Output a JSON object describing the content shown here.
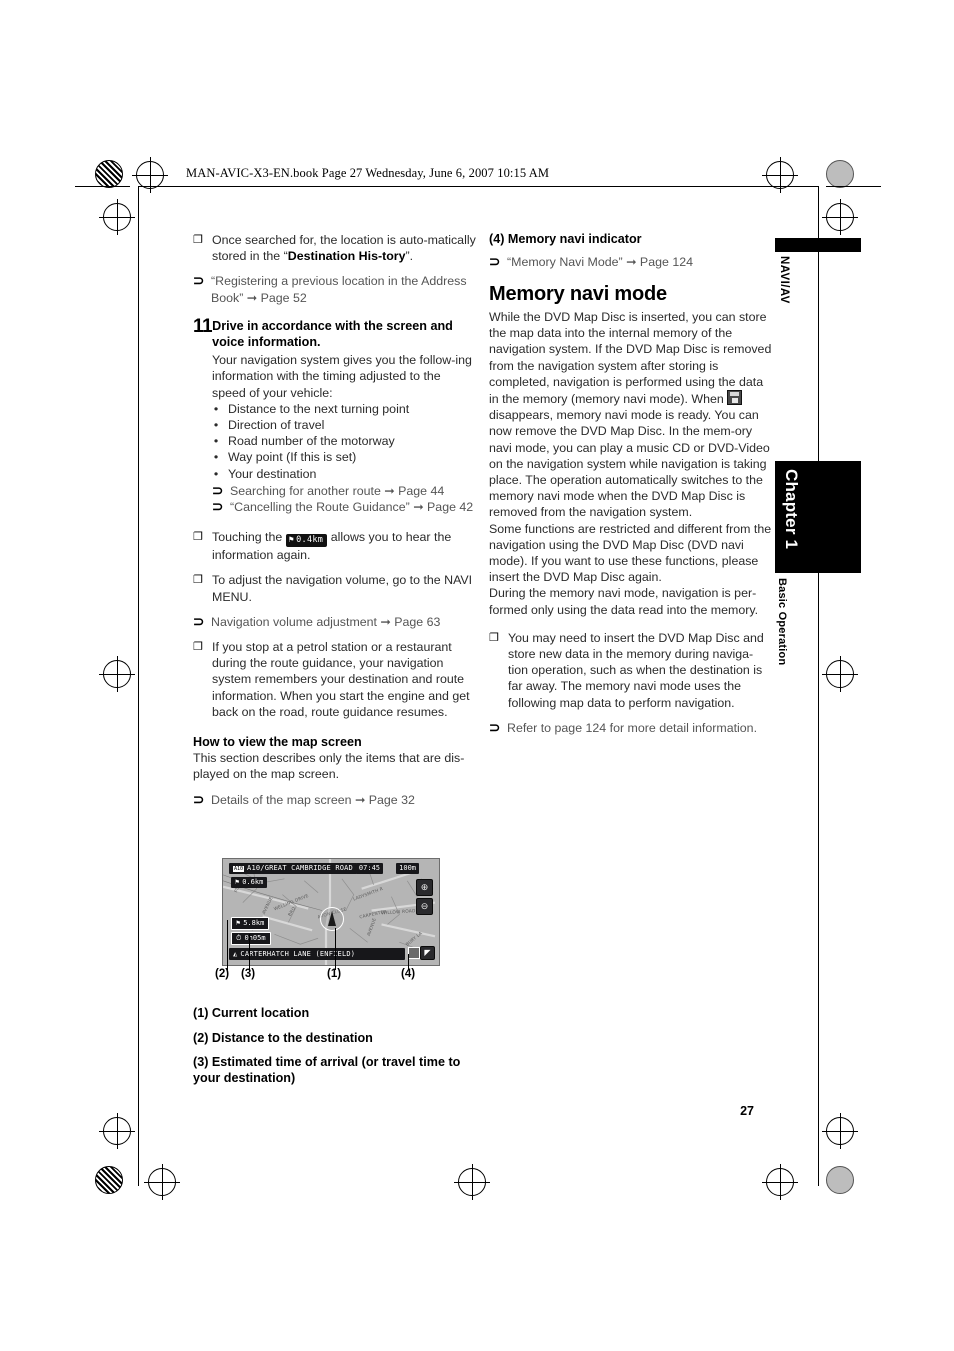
{
  "header": {
    "file_line": "MAN-AVIC-X3-EN.book  Page 27  Wednesday, June 6, 2007  10:15 AM"
  },
  "glyphs": {
    "note": "❐",
    "xref": "⊃",
    "dot": "•",
    "arrow": "➞"
  },
  "page_number": "27",
  "margin_tabs": {
    "top_tab_label": "NAVI/AV",
    "chapter_label": "Chapter 1",
    "chapter_subtitle": "Basic Operation"
  },
  "left_column": {
    "note_1": "Once searched for, the location is auto-matically stored in the “",
    "note_1_bold": "Destination His-tory",
    "note_1_tail": "”.",
    "xref_1": "“Registering a previous location in the Address Book” ➞ Page 52",
    "step_number": "11",
    "step_label": "Drive in accordance with the screen and voice information.",
    "step_body": "Your navigation system gives you the follow-ing information with the timing adjusted to the speed of your vehicle:",
    "bullets": [
      "Distance to the next turning point",
      "Direction of travel",
      "Road number of the motorway",
      "Way point (If this is set)",
      "Your destination"
    ],
    "xref_2": "Searching for another route ➞ Page 44",
    "xref_3": "“Cancelling the Route Guidance” ➞ Page 42",
    "note_2_pre": "Touching the",
    "note_2_chip_flag": "⚑",
    "note_2_chip_text": "0.4km",
    "note_2_post": "allows you to hear the information again.",
    "note_3": "To adjust the navigation volume, go to the NAVI MENU.",
    "xref_4": "Navigation volume adjustment ➞ Page 63",
    "note_4": "If you stop at a petrol station or a restaurant during the route guidance, your navigation system remembers your destination and route information. When you start the engine and get back on the road, route guidance resumes.",
    "subhead_map": "How to view the map screen",
    "map_intro": "This section describes only the items that are dis-played on the map screen.",
    "xref_5": "Details of the map screen ➞ Page 32",
    "legend": [
      "(1) Current location",
      "(2) Distance to the destination",
      "(3) Estimated time of arrival (or travel time to your destination)"
    ]
  },
  "map_figure": {
    "topbar_shield": "A10",
    "topbar_road": "A10/GREAT CAMBRIDGE ROAD",
    "next_turn_distance": "0.6km",
    "clock": "07:45",
    "scale": "100m",
    "zoom_in_icon": "⊕",
    "zoom_out_icon": "⊖",
    "distance_to_destination": "5.8km",
    "travel_time": "0h05m",
    "current_road": "CARTERHATCH LANE (ENFIELD)",
    "memory_navi_indicator_icon": "▤",
    "compass_icon": "◤",
    "flag_icon": "⚑",
    "callouts": [
      "(2)",
      "(3)",
      "(1)",
      "(4)"
    ],
    "street_labels": [
      "LADYSMITH RD",
      "CARPENTER RD",
      "WILLOW ROAD",
      "AVON CLOSE",
      "WELLING DRIVE",
      "AVENUE",
      "BURY LANE",
      "CHASE",
      "PLOUGH LANE",
      "HARDY AVENUE",
      "CARTERHATCH LANE"
    ]
  },
  "right_column": {
    "indicator_heading": "(4) Memory navi indicator",
    "indicator_xref": "“Memory Navi Mode” ➞ Page 124",
    "section_title": "Memory navi mode",
    "body_part1": "While the DVD Map Disc is inserted, you can store the map data into the internal memory of the navigation system. If the DVD Map Disc is removed from the navigation system after storing is completed, navigation is performed using the data in the memory (memory navi mode). When",
    "body_part2": "disappears, memory navi mode is ready. You can now remove the DVD Map Disc. In the mem-ory navi mode, you can play a music CD or DVD-Video on the navigation system while navigation is taking place. The operation automatically switches to the memory navi mode when the DVD Map Disc is removed from the navigation system.",
    "body_part3": "Some functions are restricted and different from the navigation using the DVD Map Disc (DVD navi mode). If you want to use these functions, please insert the DVD Map Disc again.",
    "body_part4": "During the memory navi mode, navigation is per-formed only using the data read into the memory.",
    "note_1": "You may need to insert the DVD Map Disc and store new data in the memory during naviga-tion operation, such as when the destination is far away. The memory navi mode uses the following map data to perform navigation.",
    "xref_1": "Refer to page 124 for more detail information."
  }
}
